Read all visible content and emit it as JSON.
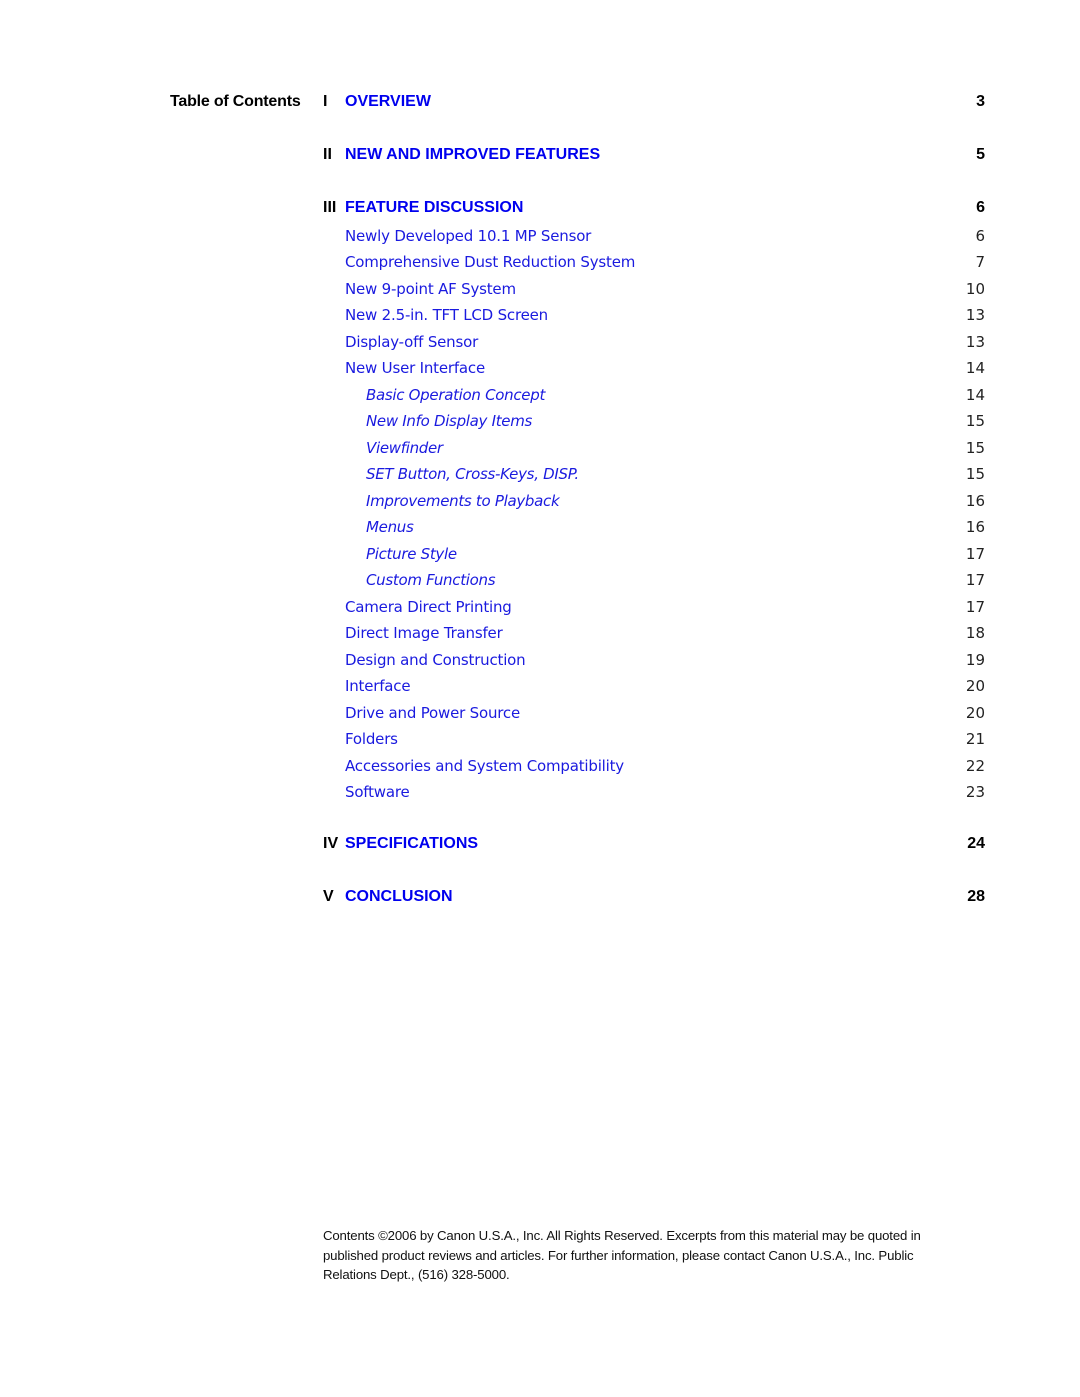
{
  "heading": "Table of Contents",
  "sections": [
    {
      "num": "I",
      "title": "OVERVIEW",
      "page": "3"
    },
    {
      "num": "II",
      "title": "NEW AND IMPROVED FEATURES",
      "page": "5"
    },
    {
      "num": "III",
      "title": "FEATURE DISCUSSION",
      "page": "6",
      "items": [
        {
          "title": "Newly Developed 10.1 MP Sensor",
          "page": "6"
        },
        {
          "title": "Comprehensive Dust Reduction System",
          "page": "7"
        },
        {
          "title": "New 9-point AF System",
          "page": "10"
        },
        {
          "title": "New 2.5-in. TFT LCD Screen",
          "page": "13"
        },
        {
          "title": "Display-off Sensor",
          "page": "13"
        },
        {
          "title": "New User Interface",
          "page": "14"
        },
        {
          "title": "Basic Operation Concept",
          "page": "14",
          "level": 3
        },
        {
          "title": "New Info Display Items",
          "page": "15",
          "level": 3
        },
        {
          "title": "Viewfinder",
          "page": "15",
          "level": 3
        },
        {
          "title": "SET Button, Cross-Keys, DISP.",
          "page": "15",
          "level": 3
        },
        {
          "title": "Improvements to Playback",
          "page": "16",
          "level": 3
        },
        {
          "title": "Menus",
          "page": "16",
          "level": 3
        },
        {
          "title": "Picture Style",
          "page": "17",
          "level": 3
        },
        {
          "title": "Custom Functions",
          "page": "17",
          "level": 3
        },
        {
          "title": "Camera Direct Printing",
          "page": "17"
        },
        {
          "title": "Direct Image Transfer",
          "page": "18"
        },
        {
          "title": "Design and Construction",
          "page": "19"
        },
        {
          "title": "Interface",
          "page": "20"
        },
        {
          "title": "Drive and Power Source",
          "page": "20"
        },
        {
          "title": "Folders",
          "page": "21"
        },
        {
          "title": "Accessories and System Compatibility",
          "page": "22"
        },
        {
          "title": "Software",
          "page": "23"
        }
      ]
    },
    {
      "num": "IV",
      "title": "SPECIFICATIONS",
      "page": "24"
    },
    {
      "num": "V",
      "title": "CONCLUSION",
      "page": "28"
    }
  ],
  "footer": "Contents ©2006 by Canon U.S.A., Inc.  All Rights Reserved.  Excerpts from this material may be quoted in published product reviews and articles.  For further information, please contact Canon U.S.A., Inc. Public Relations Dept., (516) 328-5000.",
  "colors": {
    "link": "#0000ee",
    "text": "#000000"
  }
}
